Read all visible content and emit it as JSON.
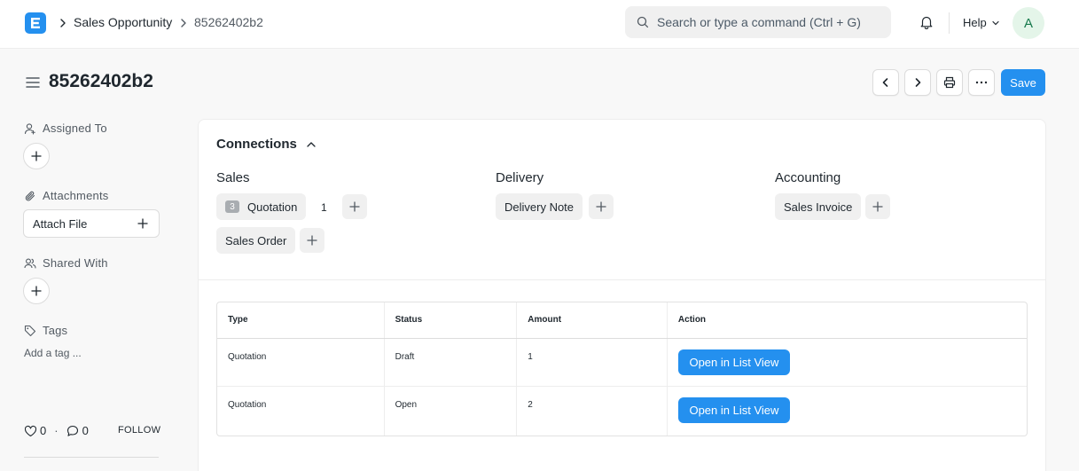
{
  "navbar": {
    "breadcrumbs": [
      "Sales Opportunity",
      "85262402b2"
    ],
    "search_placeholder": "Search or type a command (Ctrl + G)",
    "help_label": "Help",
    "avatar_initial": "A"
  },
  "page": {
    "title": "85262402b2",
    "save_label": "Save"
  },
  "sidebar": {
    "assigned_to_label": "Assigned To",
    "attachments_label": "Attachments",
    "attach_file_label": "Attach File",
    "shared_with_label": "Shared With",
    "tags_label": "Tags",
    "add_tag_label": "Add a tag ...",
    "likes_count": "0",
    "separator": "·",
    "comments_count": "0",
    "follow_label": "FOLLOW"
  },
  "connections": {
    "title": "Connections",
    "groups": [
      {
        "title": "Sales",
        "links": [
          {
            "label": "Quotation",
            "badge": "3",
            "open_count": "1"
          },
          {
            "label": "Sales Order"
          }
        ]
      },
      {
        "title": "Delivery",
        "links": [
          {
            "label": "Delivery Note"
          }
        ]
      },
      {
        "title": "Accounting",
        "links": [
          {
            "label": "Sales Invoice"
          }
        ]
      }
    ]
  },
  "table": {
    "headers": [
      "Type",
      "Status",
      "Amount",
      "Action"
    ],
    "rows": [
      {
        "type": "Quotation",
        "status": "Draft",
        "amount": "1",
        "action": "Open in List View"
      },
      {
        "type": "Quotation",
        "status": "Open",
        "amount": "2",
        "action": "Open in List View"
      }
    ]
  },
  "colors": {
    "primary": "#2490ef",
    "avatar_bg": "#e4f5e9",
    "avatar_fg": "#16794c"
  }
}
